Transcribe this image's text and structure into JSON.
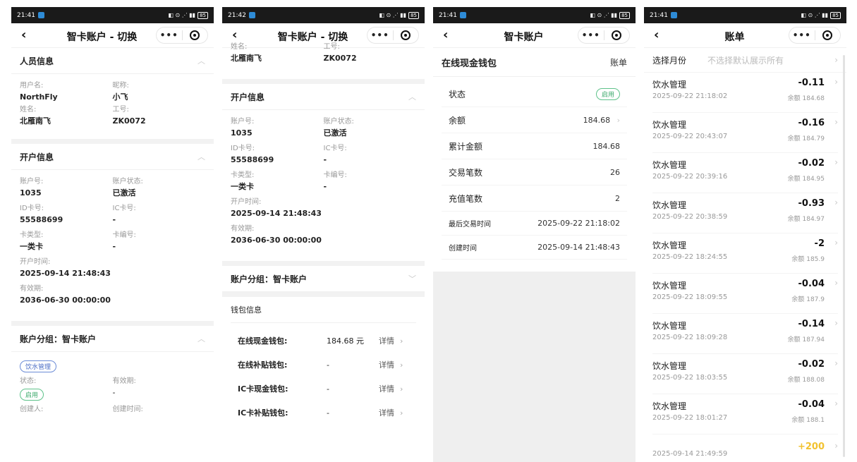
{
  "status": {
    "time1": "21:41",
    "time2": "21:42",
    "time3": "21:41",
    "time4": "21:41",
    "battery": "85"
  },
  "p1": {
    "title": "智卡账户 - 切换",
    "person_title": "人员信息",
    "username_label": "用户名:",
    "username": "NorthFly",
    "nick_label": "昵称:",
    "nick": "小飞",
    "name_label": "姓名:",
    "name": "北雁南飞",
    "job_label": "工号:",
    "job": "ZK0072",
    "account_title": "开户信息",
    "acc_label": "账户号:",
    "acc": "1035",
    "accstate_label": "账户状态:",
    "accstate": "已激活",
    "idcard_label": "ID卡号:",
    "idcard": "55588699",
    "iccard_label": "IC卡号:",
    "iccard": "-",
    "cardtype_label": "卡类型:",
    "cardtype": "一类卡",
    "cardno_label": "卡编号:",
    "cardno": "-",
    "opentime_label": "开户时间:",
    "opentime": "2025-09-14 21:48:43",
    "valid_label": "有效期:",
    "valid": "2036-06-30 00:00:00",
    "group_title": "账户分组：智卡账户",
    "tag": "饮水管理",
    "state_label": "状态:",
    "state_tag": "启用",
    "gvalid_label": "有效期:",
    "gvalid": "-",
    "creator_label": "创建人:",
    "ctime_label": "创建时间:"
  },
  "p2": {
    "title": "智卡账户 - 切换",
    "name_label": "姓名:",
    "name": "北雁南飞",
    "job_label": "工号:",
    "job": "ZK0072",
    "account_title": "开户信息",
    "acc_label": "账户号:",
    "acc": "1035",
    "accstate_label": "账户状态:",
    "accstate": "已激活",
    "idcard_label": "ID卡号:",
    "idcard": "55588699",
    "iccard_label": "IC卡号:",
    "iccard": "-",
    "cardtype_label": "卡类型:",
    "cardtype": "一类卡",
    "cardno_label": "卡编号:",
    "cardno": "-",
    "opentime_label": "开户时间:",
    "opentime": "2025-09-14 21:48:43",
    "valid_label": "有效期:",
    "valid": "2036-06-30 00:00:00",
    "group_title": "账户分组：智卡账户",
    "wallet_title": "钱包信息",
    "wallets": [
      {
        "label": "在线现金钱包:",
        "value": "184.68 元",
        "detail": "详情"
      },
      {
        "label": "在线补贴钱包:",
        "value": "-",
        "detail": "详情"
      },
      {
        "label": "IC卡现金钱包:",
        "value": "-",
        "detail": "详情"
      },
      {
        "label": "IC卡补贴钱包:",
        "value": "-",
        "detail": "详情"
      }
    ]
  },
  "p3": {
    "title": "智卡账户",
    "wallet_name": "在线现金钱包",
    "bill_link": "账单",
    "rows": [
      {
        "label": "状态",
        "value": "启用"
      },
      {
        "label": "余额",
        "value": "184.68"
      },
      {
        "label": "累计金额",
        "value": "184.68"
      },
      {
        "label": "交易笔数",
        "value": "26"
      },
      {
        "label": "充值笔数",
        "value": "2"
      },
      {
        "label": "最后交易时间",
        "value": "2025-09-22 21:18:02"
      },
      {
        "label": "创建时间",
        "value": "2025-09-14 21:48:43"
      }
    ]
  },
  "p4": {
    "title": "账单",
    "month_label": "选择月份",
    "month_placeholder": "不选择默认展示所有",
    "bills": [
      {
        "name": "饮水管理",
        "time": "2025-09-22 21:18:02",
        "amount": "-0.11",
        "balance": "余额 184.68"
      },
      {
        "name": "饮水管理",
        "time": "2025-09-22 20:43:07",
        "amount": "-0.16",
        "balance": "余额 184.79"
      },
      {
        "name": "饮水管理",
        "time": "2025-09-22 20:39:16",
        "amount": "-0.02",
        "balance": "余额 184.95"
      },
      {
        "name": "饮水管理",
        "time": "2025-09-22 20:38:59",
        "amount": "-0.93",
        "balance": "余额 184.97"
      },
      {
        "name": "饮水管理",
        "time": "2025-09-22 18:24:55",
        "amount": "-2",
        "balance": "余额 185.9"
      },
      {
        "name": "饮水管理",
        "time": "2025-09-22 18:09:55",
        "amount": "-0.04",
        "balance": "余额 187.9"
      },
      {
        "name": "饮水管理",
        "time": "2025-09-22 18:09:28",
        "amount": "-0.14",
        "balance": "余额 187.94"
      },
      {
        "name": "饮水管理",
        "time": "2025-09-22 18:03:55",
        "amount": "-0.02",
        "balance": "余额 188.08"
      },
      {
        "name": "饮水管理",
        "time": "2025-09-22 18:01:27",
        "amount": "-0.04",
        "balance": "余额 188.1"
      }
    ],
    "last_time": "2025-09-14 21:49:59",
    "last_amount": "+200"
  },
  "icons": {
    "back": "back-arrow-icon",
    "more": "more-dots-icon",
    "target": "target-circle-icon",
    "chevron": "chevron-right-icon"
  },
  "colors": {
    "tag_blue": "#4a6cc5",
    "tag_green": "#3aa86a",
    "positive": "#f2c230"
  }
}
